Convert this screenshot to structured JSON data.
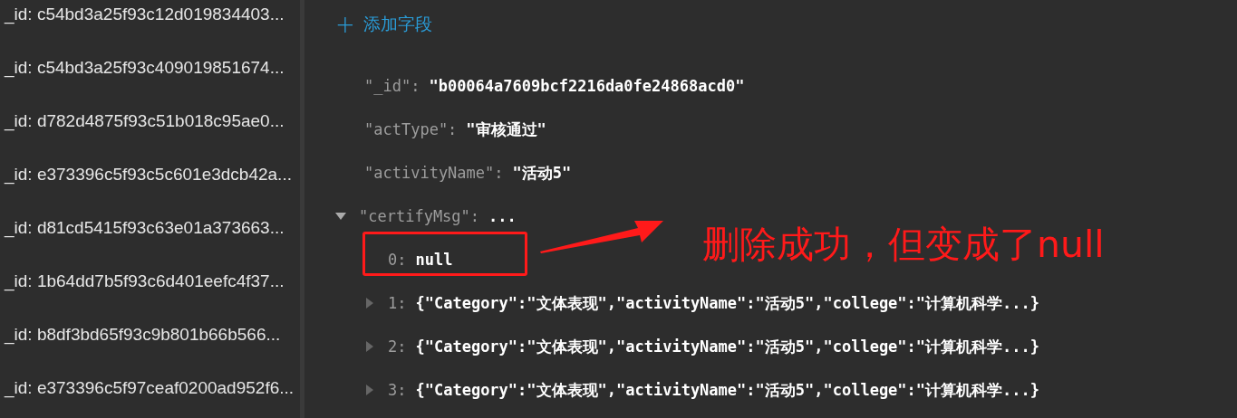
{
  "sidebar": {
    "items": [
      {
        "label": "_id: c54bd3a25f93c12d019834403..."
      },
      {
        "label": "_id: c54bd3a25f93c409019851674..."
      },
      {
        "label": "_id: d782d4875f93c51b018c95ae0..."
      },
      {
        "label": "_id: e373396c5f93c5c601e3dcb42a..."
      },
      {
        "label": "_id: d81cd5415f93c63e01a373663..."
      },
      {
        "label": "_id: 1b64dd7b5f93c6d401eefc4f37..."
      },
      {
        "label": "_id: b8df3bd65f93c9b801b66b566..."
      },
      {
        "label": "_id: e373396c5f97ceaf0200ad952f6..."
      }
    ]
  },
  "add_field_button": {
    "icon": "+",
    "label": "添加字段"
  },
  "fields": [
    {
      "key": "\"_id\":",
      "value": "\"b00064a7609bcf2216da0fe24868acd0\""
    },
    {
      "key": "\"actType\":",
      "value": "\"审核通过\""
    },
    {
      "key": "\"activityName\":",
      "value": "\"活动5\""
    },
    {
      "key": "\"certifyMsg\":",
      "value": "...",
      "expanded": true,
      "children": [
        {
          "key": "0:",
          "value": "null"
        },
        {
          "key": "1:",
          "value": "{\"Category\":\"文体表现\",\"activityName\":\"活动5\",\"college\":\"计算机科学...}",
          "expanded": false
        },
        {
          "key": "2:",
          "value": "{\"Category\":\"文体表现\",\"activityName\":\"活动5\",\"college\":\"计算机科学...}",
          "expanded": false
        },
        {
          "key": "3:",
          "value": "{\"Category\":\"文体表现\",\"activityName\":\"活动5\",\"college\":\"计算机科学...}",
          "expanded": false
        }
      ]
    }
  ],
  "annotation": {
    "text": "删除成功，但变成了null"
  }
}
